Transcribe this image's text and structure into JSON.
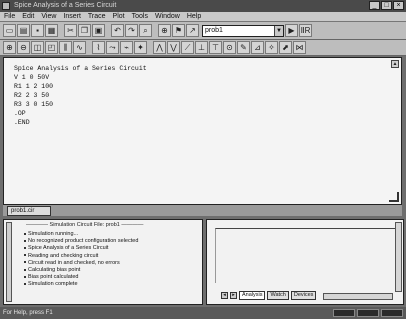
{
  "window": {
    "title": "Spice Analysis of a Series Circuit",
    "controls": [
      "_",
      "□",
      "×"
    ]
  },
  "menubar": {
    "items": [
      "File",
      "Edit",
      "View",
      "Insert",
      "Trace",
      "Plot",
      "Tools",
      "Window",
      "Help"
    ]
  },
  "toolbar1": {
    "buttons": [
      {
        "name": "new-icon",
        "glyph": "▭"
      },
      {
        "name": "open-icon",
        "glyph": "▤"
      },
      {
        "name": "save-icon",
        "glyph": "▪"
      },
      {
        "name": "print-icon",
        "glyph": "▦"
      },
      {
        "name": "cut-icon",
        "glyph": "✂"
      },
      {
        "name": "copy-icon",
        "glyph": "❐"
      },
      {
        "name": "paste-icon",
        "glyph": "▣"
      },
      {
        "name": "undo-icon",
        "glyph": "↶"
      },
      {
        "name": "redo-icon",
        "glyph": "↷"
      },
      {
        "name": "find-icon",
        "glyph": "⌕"
      },
      {
        "name": "zoom-icon",
        "glyph": "⊕"
      },
      {
        "name": "bookmark-icon",
        "glyph": "⚑"
      },
      {
        "name": "arrow-icon",
        "glyph": "↗"
      }
    ],
    "profile_value": "prob1",
    "run_glyph": "▶",
    "extra_glyph": "ⅡR"
  },
  "toolbar2": {
    "buttons": [
      {
        "name": "zoom-in-icon",
        "glyph": "⊕"
      },
      {
        "name": "zoom-out-icon",
        "glyph": "⊖"
      },
      {
        "name": "zoom-area-icon",
        "glyph": "◫"
      },
      {
        "name": "zoom-fit-icon",
        "glyph": "◰"
      },
      {
        "name": "log-x-icon",
        "glyph": "⫼"
      },
      {
        "name": "fourier-icon",
        "glyph": "∿"
      },
      {
        "name": "perf-icon",
        "glyph": "⌇"
      },
      {
        "name": "add-trace-icon",
        "glyph": "⤳"
      },
      {
        "name": "plot-icon",
        "glyph": "⌁"
      },
      {
        "name": "cursor-icon",
        "glyph": "✦"
      },
      {
        "name": "peak-icon",
        "glyph": "⋀"
      },
      {
        "name": "trough-icon",
        "glyph": "⋁"
      },
      {
        "name": "slope-icon",
        "glyph": "⟋"
      },
      {
        "name": "min-icon",
        "glyph": "⊥"
      },
      {
        "name": "max-icon",
        "glyph": "⊤"
      },
      {
        "name": "point-icon",
        "glyph": "⊙"
      },
      {
        "name": "label-icon",
        "glyph": "✎"
      },
      {
        "name": "mark-icon",
        "glyph": "⊿"
      },
      {
        "name": "text-icon",
        "glyph": "✧"
      },
      {
        "name": "arrow2-icon",
        "glyph": "⬈"
      },
      {
        "name": "misc-icon",
        "glyph": "⋈"
      }
    ]
  },
  "editor": {
    "lines": [
      "Spice Analysis of a Series Circuit",
      "V 1 0 50V",
      "R1 1 2 100",
      "R2 2 3 50",
      "R3 3 0 150",
      ".OP",
      ".END"
    ],
    "tab_label": "prob1.cir"
  },
  "output": {
    "header": "Simulation Circuit File: prob1",
    "lines": [
      "Simulation running...",
      "No recognized product configuration selected",
      "Spice Analysis of a Series Circuit",
      "Reading and checking circuit",
      "Circuit read in and checked, no errors",
      "Calculating bias point",
      "Bias point calculated",
      "Simulation complete"
    ],
    "tabs": [
      "Analysis",
      "Watch",
      "Devices"
    ]
  },
  "status": {
    "text": "For Help, press F1"
  }
}
